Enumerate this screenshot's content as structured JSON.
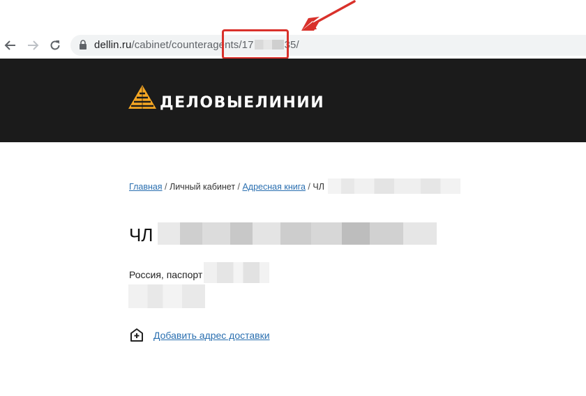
{
  "browser": {
    "url_host": "dellin.ru",
    "url_path_start": "/cabinet/counteragents/17",
    "url_path_end": "35/"
  },
  "header": {
    "logo_text": "ДЕЛОВЫЕЛИНИИ"
  },
  "breadcrumb": {
    "home": "Главная",
    "sep1": " / ",
    "cabinet": "Личный кабинет",
    "sep2": " / ",
    "addressbook": "Адресная книга",
    "sep3": " / ",
    "current": "ЧЛ"
  },
  "page": {
    "title": "ЧЛ",
    "country_passport": "Россия, паспорт",
    "add_address_label": "Добавить адрес доставки"
  },
  "colors": {
    "header_bg": "#1b1b1b",
    "accent_logo": "#f5a623",
    "link": "#2a6fb0",
    "highlight": "#d9312b"
  }
}
